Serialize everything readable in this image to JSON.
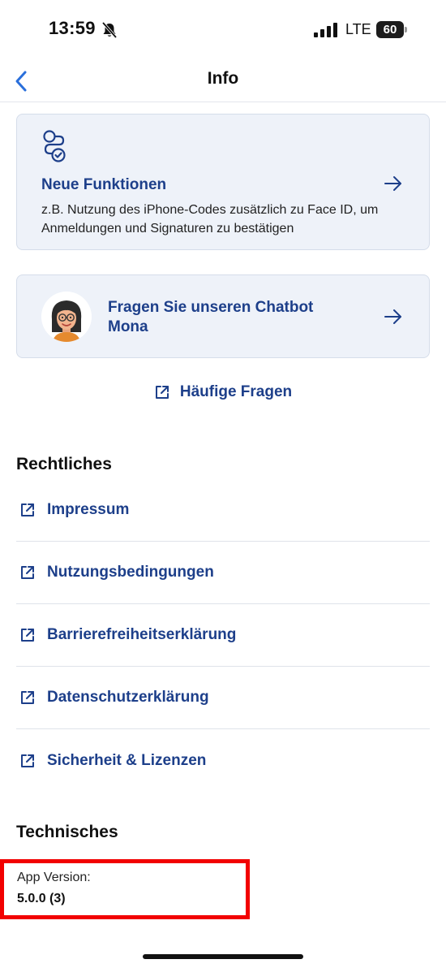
{
  "status_bar": {
    "time": "13:59",
    "network": "LTE",
    "battery": "60",
    "icons": [
      "bell-slash-icon",
      "signal-icon"
    ]
  },
  "nav": {
    "title": "Info",
    "back_icon": "chevron-left-icon"
  },
  "features_card": {
    "icon": "flow-check-icon",
    "title": "Neue Funktionen",
    "description": "z.B. Nutzung des iPhone-Codes zusätzlich zu Face ID, um Anmeldungen und Signaturen zu bestätigen",
    "arrow_icon": "arrow-right-icon"
  },
  "chatbot_card": {
    "avatar": "mona-avatar",
    "label": "Fragen Sie unseren Chatbot Mona",
    "arrow_icon": "arrow-right-icon"
  },
  "faq_link": {
    "label": "Häufige Fragen",
    "icon": "external-link-icon"
  },
  "legal": {
    "heading": "Rechtliches",
    "items": [
      {
        "label": "Impressum"
      },
      {
        "label": "Nutzungsbedingungen"
      },
      {
        "label": "Barrierefreiheitserklärung"
      },
      {
        "label": "Datenschutzerklärung"
      },
      {
        "label": "Sicherheit & Lizenzen"
      }
    ]
  },
  "technical": {
    "heading": "Technisches",
    "version_label": "App Version:",
    "version_value": "5.0.0 (3)"
  },
  "colors": {
    "accent": "#1d3f8a",
    "card_bg": "#eef2f9",
    "highlight": "#f20000"
  }
}
